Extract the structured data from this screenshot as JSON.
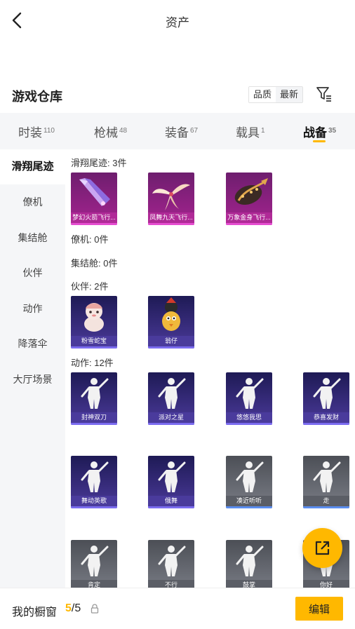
{
  "header": {
    "title": "资产"
  },
  "warehouse": {
    "title": "游戏仓库",
    "sort_options": [
      "品质",
      "最新"
    ],
    "sort_selected": "品质"
  },
  "tabs": [
    {
      "label": "时装",
      "count": "110"
    },
    {
      "label": "枪械",
      "count": "48"
    },
    {
      "label": "装备",
      "count": "67"
    },
    {
      "label": "载具",
      "count": "1"
    },
    {
      "label": "战备",
      "count": "35",
      "active": true
    }
  ],
  "sidebar": {
    "items": [
      {
        "label": "滑翔尾迹",
        "active": true
      },
      {
        "label": "僚机"
      },
      {
        "label": "集结舱"
      },
      {
        "label": "伙伴"
      },
      {
        "label": "动作"
      },
      {
        "label": "降落伞"
      },
      {
        "label": "大厅场景"
      }
    ]
  },
  "content": {
    "glide": {
      "label": "滑翔尾迹: 3件",
      "items": [
        "梦幻火箭飞行...",
        "凤舞九天飞行...",
        "万象金身飞行..."
      ]
    },
    "wingman": {
      "label": "僚机: 0件"
    },
    "pod": {
      "label": "集结舱: 0件"
    },
    "partner": {
      "label": "伙伴: 2件",
      "items": [
        "粉雪蛇宝",
        "翁仔"
      ]
    },
    "emote": {
      "label": "动作: 12件",
      "items": [
        "封神双刀",
        "派对之星",
        "悠悠我思",
        "恭喜发财",
        "舞动英歌",
        "俄舞",
        "凑近听听",
        "走",
        "肯定",
        "不行",
        "鼓掌",
        "你好"
      ]
    }
  },
  "bottom": {
    "showcase_label": "我的橱窗",
    "count_current": "5",
    "count_total": "/5",
    "edit_label": "编辑"
  },
  "colors": {
    "accent": "#ffb800",
    "legendary": "#a4238f",
    "epic": "#4b3a9a",
    "common": "#7a7d86"
  },
  "icons": [
    "back-arrow-icon",
    "filter-icon",
    "lock-icon",
    "share-icon"
  ]
}
